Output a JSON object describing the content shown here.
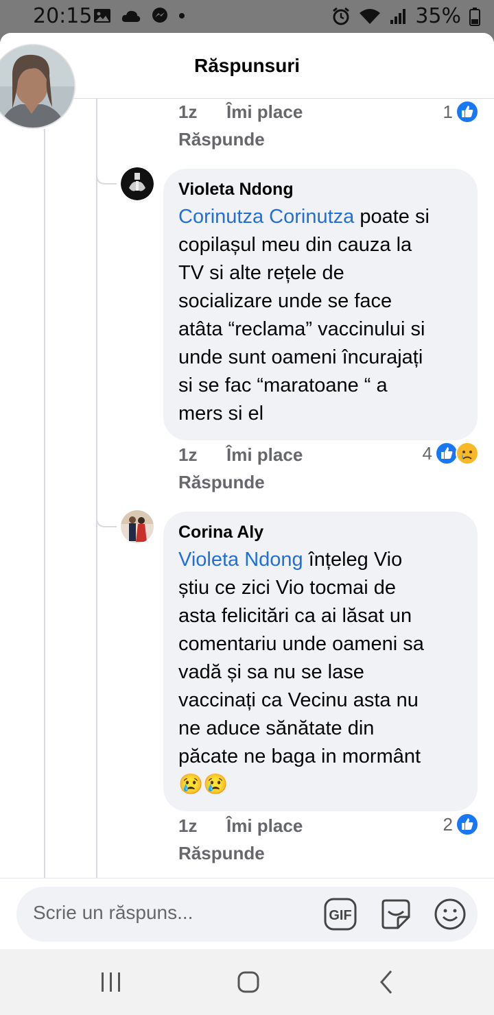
{
  "status_bar": {
    "time": "20:15",
    "battery_percent": "35%",
    "icons_left": [
      "image-icon",
      "cloud-icon",
      "messenger-icon",
      "dot-icon"
    ],
    "icons_right": [
      "alarm-icon",
      "wifi-icon",
      "signal-icon",
      "battery-icon"
    ]
  },
  "header": {
    "title": "Răspunsuri"
  },
  "thread": {
    "prev_meta": {
      "time": "1z",
      "like_label": "Îmi place",
      "reply_label": "Răspunde",
      "reaction_count": "1",
      "reactions": [
        "like-reaction-icon"
      ]
    },
    "comments": [
      {
        "author": "Violeta Ndong",
        "mention": "Corinutza Corinutza",
        "line1": "poate si",
        "lines": [
          "copilașul meu din cauza la",
          "TV si alte rețele de",
          "socializare unde se face",
          "atâta “reclama” vaccinului si",
          "unde sunt oameni încurajați",
          "si se fac “maratoane “ a",
          "mers si el"
        ],
        "time": "1z",
        "like_label": "Îmi place",
        "reply_label": "Răspunde",
        "reaction_count": "4",
        "reactions": [
          "like-reaction-icon",
          "sad-reaction-icon"
        ]
      },
      {
        "author": "Corina Aly",
        "mention": "Violeta Ndong",
        "line1": "înțeleg Vio",
        "lines": [
          "știu ce zici Vio tocmai de",
          "asta felicitări ca ai lăsat un",
          "comentariu unde oameni sa",
          "vadă și sa nu se lase",
          "vaccinați ca Vecinu asta nu",
          "ne aduce sănătate din",
          "păcate ne baga in mormânt"
        ],
        "emoji_line": "😢😢",
        "time": "1z",
        "like_label": "Îmi place",
        "reply_label": "Răspunde",
        "reaction_count": "2",
        "reactions": [
          "like-reaction-icon"
        ]
      }
    ]
  },
  "composer": {
    "placeholder": "Scrie un răspuns...",
    "icons": [
      "gif-icon",
      "sticker-icon",
      "emoji-icon"
    ]
  },
  "nav_bar": {
    "buttons": [
      "recent-apps-icon",
      "home-icon",
      "back-icon"
    ]
  },
  "colors": {
    "mention": "#216fdb",
    "like_blue": "#1877f2",
    "bubble_bg": "#f0f2f5",
    "meta_gray": "#65676b"
  }
}
